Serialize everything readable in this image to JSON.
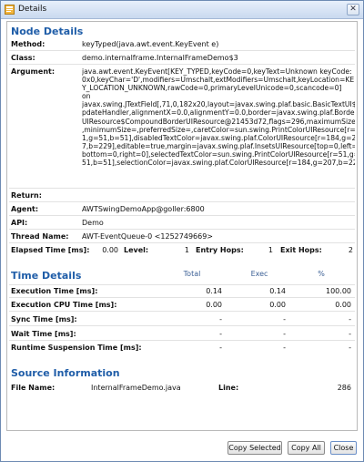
{
  "window": {
    "title": "Details",
    "close_glyph": "✕"
  },
  "node_details": {
    "heading": "Node Details",
    "method_label": "Method:",
    "method": "keyTyped(java.awt.event.KeyEvent e)",
    "class_label": "Class:",
    "class": "demo.internalframe.InternalFrameDemo$3",
    "argument_label": "Argument:",
    "argument": "java.awt.event.KeyEvent[KEY_TYPED,keyCode=0,keyText=Unknown keyCode:\n0x0,keyChar='D',modifiers=Umschalt,extModifiers=Umschalt,keyLocation=KE\nY_LOCATION_UNKNOWN,rawCode=0,primaryLevelUnicode=0,scancode=0]\non\njavax.swing.JTextField[,71,0,182x20,layout=javax.swing.plaf.basic.BasicTextUI$U\npdateHandler,alignmentX=0.0,alignmentY=0.0,border=javax.swing.plaf.Border\nUIResource$CompoundBorderUIResource@21453d72,flags=296,maximumSize=\n,minimumSize=,preferredSize=,caretColor=sun.swing.PrintColorUIResource[r=\n1,g=51,b=51],disabledTextColor=javax.swing.plaf.ColorUIResource[r=184,g=20\n7,b=229],editable=true,margin=javax.swing.plaf.InsetsUIResource[top=0,left=0,\nbottom=0,right=0],selectedTextColor=sun.swing.PrintColorUIResource[r=51,g=\n51,b=51],selectionColor=javax.swing.plaf.ColorUIResource[r=184,g=207,b=229]",
    "return_label": "Return:",
    "return": "",
    "agent_label": "Agent:",
    "agent": "AWTSwingDemoApp@goller:6800",
    "api_label": "API:",
    "api": "Demo",
    "thread_label": "Thread Name:",
    "thread": "AWT-EventQueue-0 <1252749669>",
    "elapsed_label": "Elapsed Time [ms]:",
    "elapsed": "0.00",
    "level_label": "Level:",
    "level": "1",
    "entry_hops_label": "Entry Hops:",
    "entry_hops": "1",
    "exit_hops_label": "Exit Hops:",
    "exit_hops": "2"
  },
  "time_details": {
    "heading": "Time Details",
    "col_total": "Total",
    "col_exec": "Exec",
    "col_pct": "%",
    "rows": [
      {
        "label": "Execution Time [ms]:",
        "total": "0.14",
        "exec": "0.14",
        "pct": "100.00"
      },
      {
        "label": "Execution CPU Time [ms]:",
        "total": "0.00",
        "exec": "0.00",
        "pct": "0.00"
      },
      {
        "label": "Sync Time [ms]:",
        "total": "-",
        "exec": "-",
        "pct": "-"
      },
      {
        "label": "Wait Time [ms]:",
        "total": "-",
        "exec": "-",
        "pct": "-"
      },
      {
        "label": "Runtime Suspension Time [ms]:",
        "total": "-",
        "exec": "-",
        "pct": "-"
      }
    ]
  },
  "source_info": {
    "heading": "Source Information",
    "file_label": "File Name:",
    "file": "InternalFrameDemo.java",
    "line_label": "Line:",
    "line": "286"
  },
  "buttons": {
    "copy_selected": "Copy Selected",
    "copy_all": "Copy All",
    "close": "Close"
  }
}
